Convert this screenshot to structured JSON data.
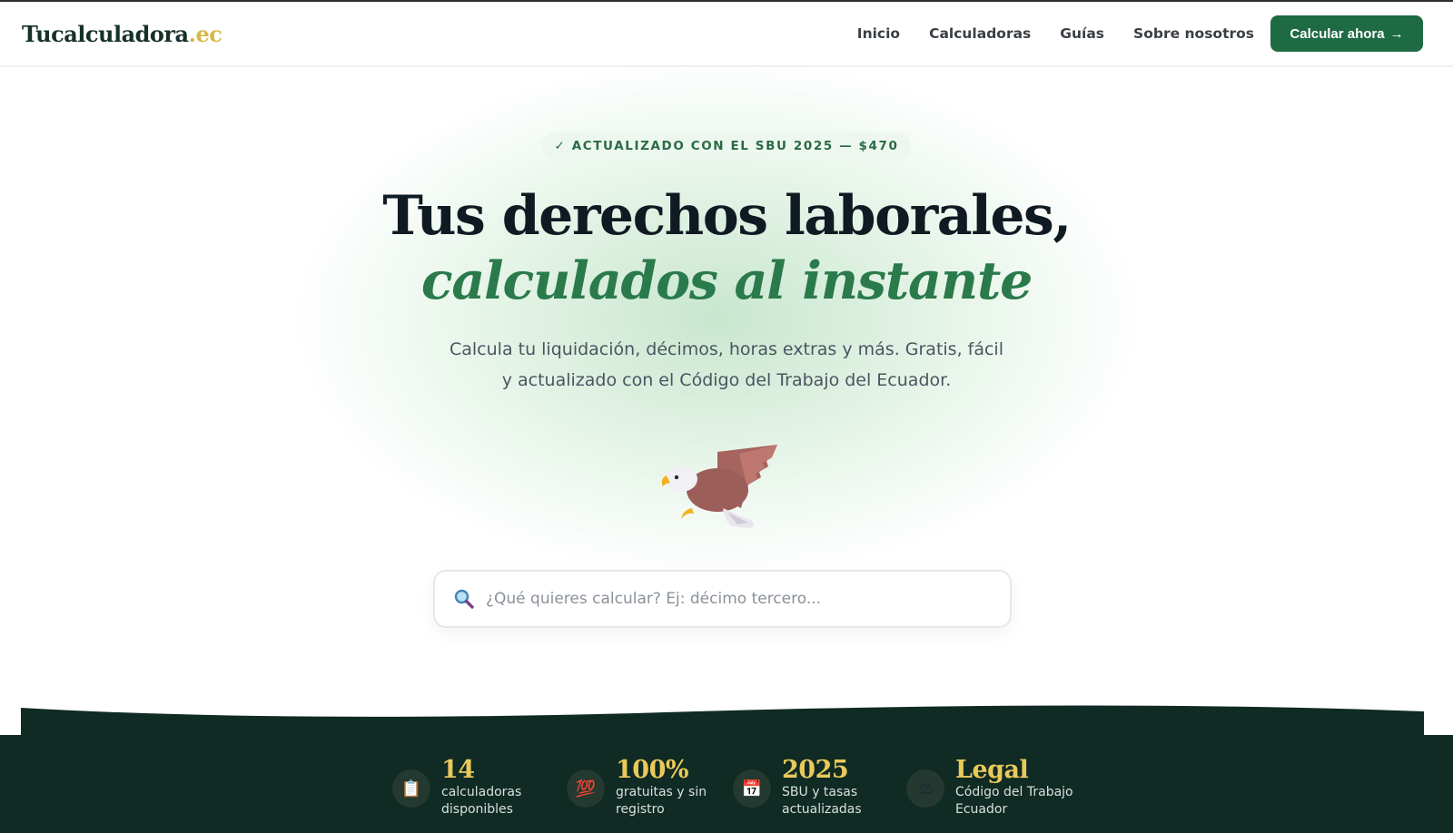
{
  "header": {
    "logo_main": "Tucalculadora",
    "logo_tld": ".ec",
    "nav": [
      "Inicio",
      "Calculadoras",
      "Guías",
      "Sobre nosotros"
    ],
    "cta_label": "Calcular ahora",
    "cta_arrow": "→"
  },
  "hero": {
    "badge": "✓ ACTUALIZADO CON EL SBU 2025 — $470",
    "title_line1": "Tus derechos laborales,",
    "title_line2": "calculados al instante",
    "subtitle": "Calcula tu liquidación, décimos, horas extras y más. Gratis, fácil y actualizado con el Código del Trabajo del Ecuador.",
    "illustration": "eagle-icon"
  },
  "search": {
    "icon": "magnifier-icon",
    "placeholder": "¿Qué quieres calcular? Ej: décimo tercero..."
  },
  "stats": [
    {
      "icon": "clipboard-icon",
      "glyph": "📋",
      "value": "14",
      "label": "calculadoras disponibles"
    },
    {
      "icon": "hundred-icon",
      "glyph": "💯",
      "value": "100%",
      "label": "gratuitas y sin registro"
    },
    {
      "icon": "calendar-icon",
      "glyph": "📅",
      "value": "2025",
      "label": "SBU y tasas actualizadas"
    },
    {
      "icon": "scales-icon",
      "glyph": "⚖",
      "value": "Legal",
      "label": "Código del Trabajo Ecuador"
    }
  ],
  "colors": {
    "brand_green": "#1e6a43",
    "accent_green": "#2a7a4b",
    "dark_band": "#102a24",
    "gold": "#e9c95a"
  }
}
